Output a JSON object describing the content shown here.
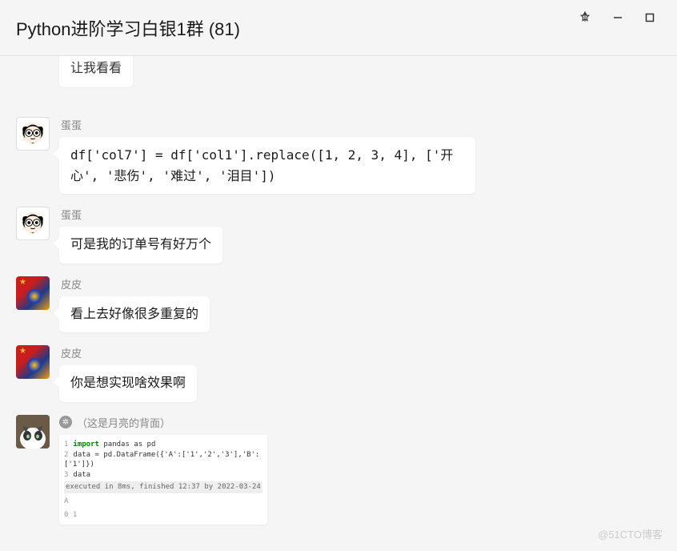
{
  "window": {
    "title": "Python进阶学习白银1群 (81)"
  },
  "messages": [
    {
      "sender": "",
      "text": "让我看看",
      "avatar": "none",
      "partial": true
    },
    {
      "sender": "蛋蛋",
      "text": "df['col7'] = df['col1'].replace([1, 2, 3, 4], ['开心', '悲伤', '难过', '泪目'])",
      "avatar": "dandan",
      "code": true
    },
    {
      "sender": "蛋蛋",
      "text": "可是我的订单号有好万个",
      "avatar": "dandan"
    },
    {
      "sender": "皮皮",
      "text": "看上去好像很多重复的",
      "avatar": "pipi"
    },
    {
      "sender": "皮皮",
      "text": "你是想实现啥效果啊",
      "avatar": "pipi"
    },
    {
      "sender": "（这是月亮的背面）",
      "avatar": "cat",
      "badge": true,
      "image_snippet": {
        "line1_kw": "import",
        "line1_rest": " pandas as pd",
        "line2": "data = pd.DataFrame({'A':['1','2','3'],'B':['1']})",
        "line3": "data",
        "status": "executed in 8ms, finished 12:37 by 2022-03-24",
        "out_label": "A",
        "out_row": "0  1"
      }
    }
  ],
  "watermark": "@51CTO博客"
}
